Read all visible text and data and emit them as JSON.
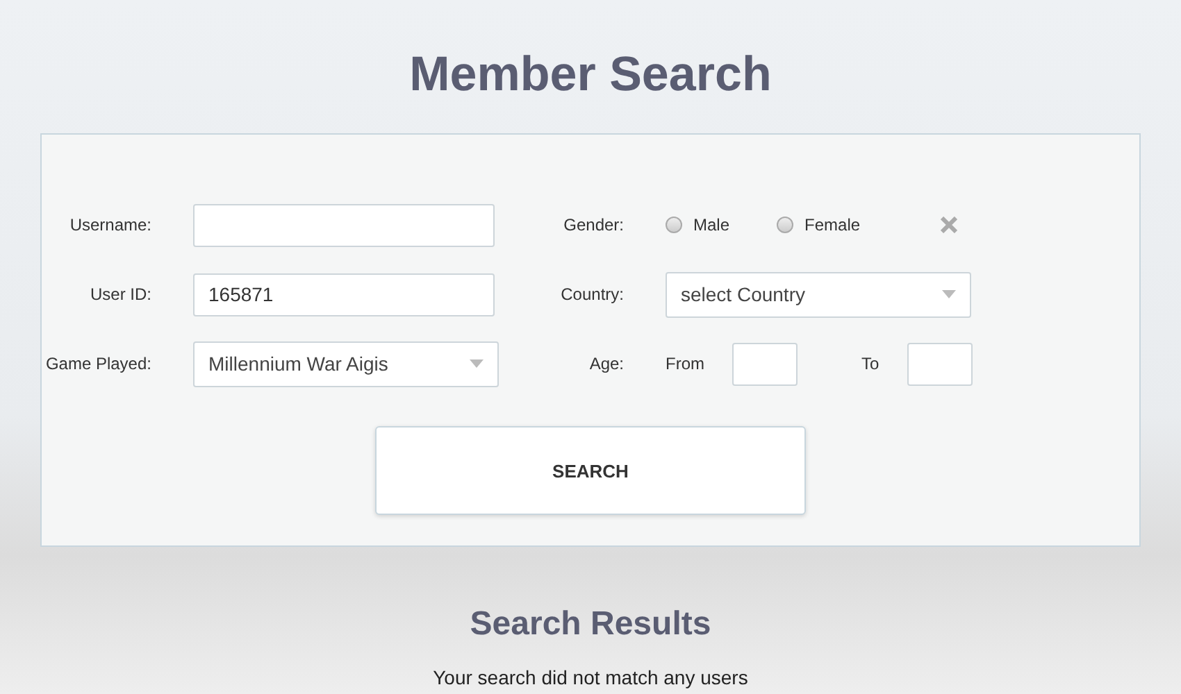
{
  "title": "Member Search",
  "form": {
    "username": {
      "label": "Username:"
    },
    "user_id": {
      "label": "User ID:",
      "value": "165871"
    },
    "game_played": {
      "label": "Game Played:",
      "value": "Millennium War Aigis"
    },
    "gender": {
      "label": "Gender:",
      "options": [
        {
          "label": "Male",
          "selected": false
        },
        {
          "label": "Female",
          "selected": false
        }
      ]
    },
    "country": {
      "label": "Country:",
      "value": "select Country"
    },
    "age": {
      "label": "Age:",
      "from_label": "From",
      "to_label": "To"
    },
    "search_button": "SEARCH"
  },
  "results": {
    "title": "Search Results",
    "message": "Your search did not match any users"
  }
}
